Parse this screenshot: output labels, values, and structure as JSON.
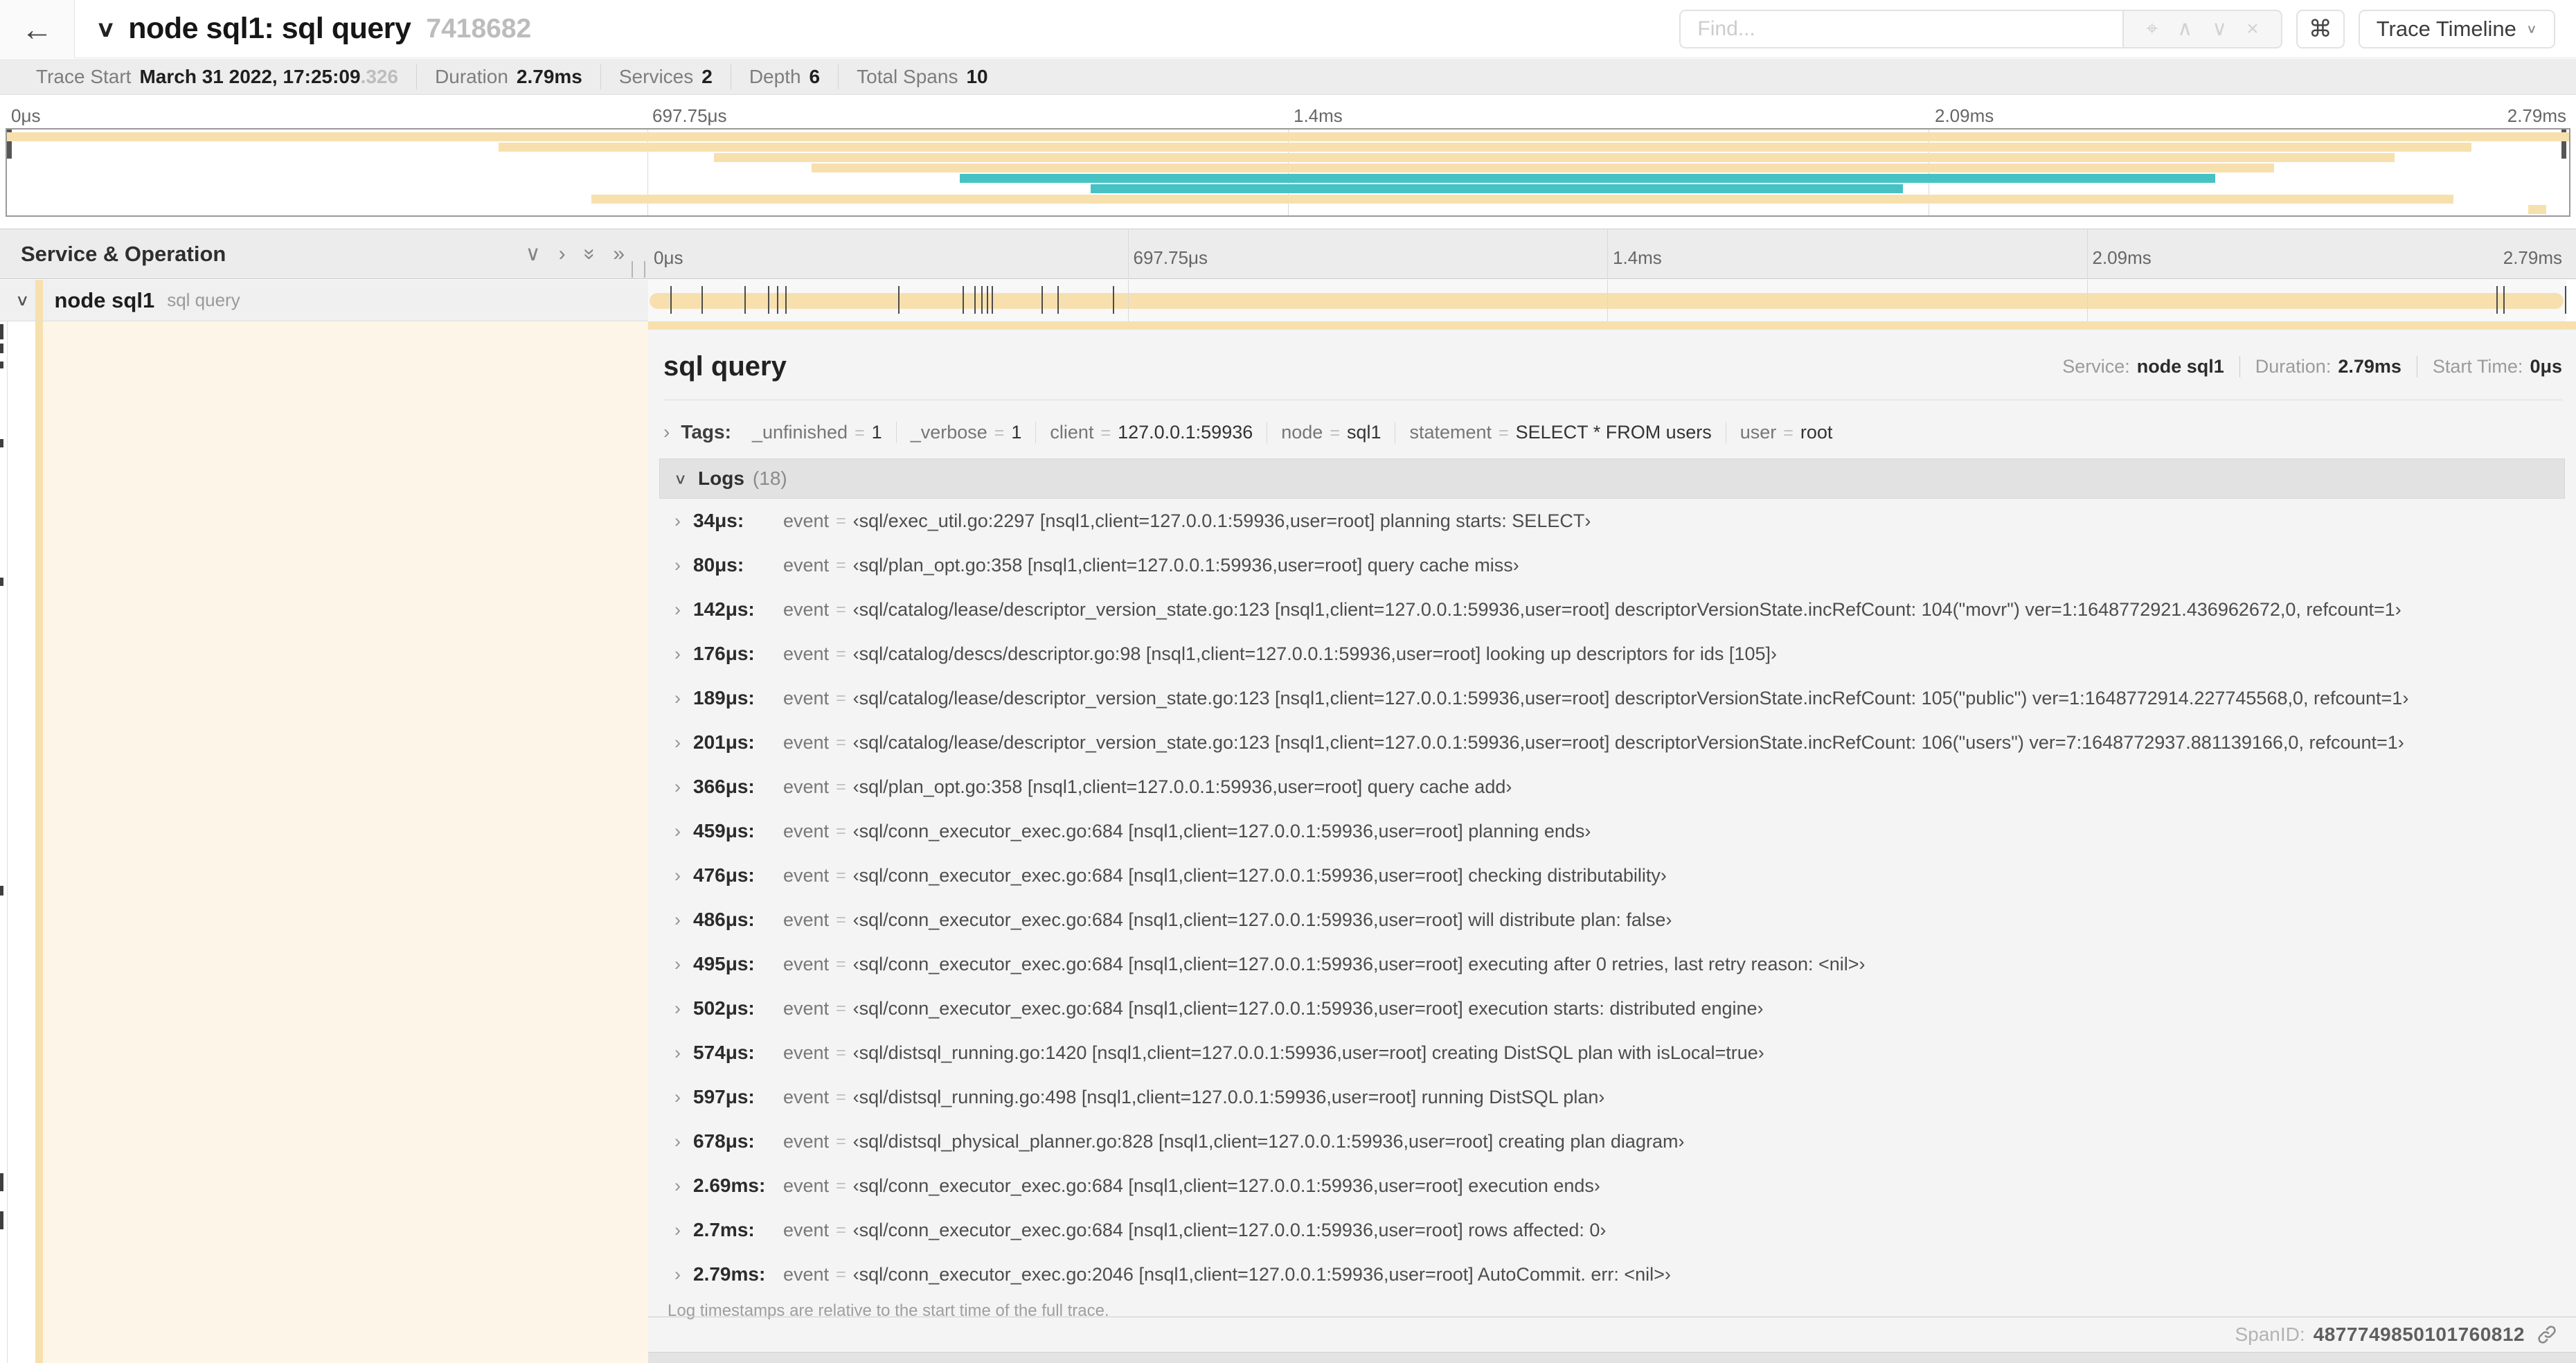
{
  "accent_colors": {
    "span_tan": "#f7e0ae",
    "span_teal": "#47c2c4",
    "detail_cream": "#fdf6e8"
  },
  "topbar": {
    "title": "node sql1: sql query",
    "trace_id": "7418682",
    "find_placeholder": "Find...",
    "shortcut_key": "⌘",
    "view_select_label": "Trace Timeline"
  },
  "meta": {
    "items": [
      {
        "label": "Trace Start",
        "value": "March 31 2022, 17:25:09",
        "suffix": ".326"
      },
      {
        "label": "Duration",
        "value": "2.79ms"
      },
      {
        "label": "Services",
        "value": "2"
      },
      {
        "label": "Depth",
        "value": "6"
      },
      {
        "label": "Total Spans",
        "value": "10"
      }
    ]
  },
  "ruler_labels": [
    "0μs",
    "697.75μs",
    "1.4ms",
    "2.09ms",
    "2.79ms"
  ],
  "duration_us": 2790,
  "minimap": {
    "spans": [
      {
        "row": 0,
        "start": 0.0,
        "end": 1.0,
        "color": "#f7e0ae"
      },
      {
        "row": 1,
        "start": 0.192,
        "end": 0.962,
        "color": "#f7e0ae"
      },
      {
        "row": 2,
        "start": 0.276,
        "end": 0.932,
        "color": "#f7e0ae"
      },
      {
        "row": 3,
        "start": 0.314,
        "end": 0.885,
        "color": "#f7e0ae"
      },
      {
        "row": 4,
        "start": 0.372,
        "end": 0.862,
        "color": "#47c2c4"
      },
      {
        "row": 5,
        "start": 0.423,
        "end": 0.74,
        "color": "#47c2c4"
      },
      {
        "row": 6,
        "start": 0.228,
        "end": 0.955,
        "color": "#f7e0ae"
      },
      {
        "row": 7,
        "start": 0.984,
        "end": 0.991,
        "color": "#f7e0ae"
      }
    ]
  },
  "timeline": {
    "column_header": "Service & Operation",
    "span": {
      "service": "node sql1",
      "operation": "sql query"
    }
  },
  "detail": {
    "title": "sql query",
    "overview": [
      {
        "label": "Service:",
        "value": "node sql1"
      },
      {
        "label": "Duration:",
        "value": "2.79ms"
      },
      {
        "label": "Start Time:",
        "value": "0μs"
      }
    ],
    "tags_label": "Tags:",
    "tags": [
      {
        "key": "_unfinished",
        "value": "1"
      },
      {
        "key": "_verbose",
        "value": "1"
      },
      {
        "key": "client",
        "value": "127.0.0.1:59936"
      },
      {
        "key": "node",
        "value": "sql1"
      },
      {
        "key": "statement",
        "value": "SELECT * FROM users"
      },
      {
        "key": "user",
        "value": "root"
      }
    ],
    "logs_label": "Logs",
    "logs_count": "(18)",
    "log_field_key": "event",
    "logs": [
      {
        "time": "34μs",
        "t": 34,
        "value": "‹sql/exec_util.go:2297 [nsql1,client=127.0.0.1:59936,user=root] planning starts: SELECT›"
      },
      {
        "time": "80μs",
        "t": 80,
        "value": "‹sql/plan_opt.go:358 [nsql1,client=127.0.0.1:59936,user=root] query cache miss›"
      },
      {
        "time": "142μs",
        "t": 142,
        "value": "‹sql/catalog/lease/descriptor_version_state.go:123 [nsql1,client=127.0.0.1:59936,user=root] descriptorVersionState.incRefCount: 104(\"movr\") ver=1:1648772921.436962672,0, refcount=1›"
      },
      {
        "time": "176μs",
        "t": 176,
        "value": "‹sql/catalog/descs/descriptor.go:98 [nsql1,client=127.0.0.1:59936,user=root] looking up descriptors for ids [105]›"
      },
      {
        "time": "189μs",
        "t": 189,
        "value": "‹sql/catalog/lease/descriptor_version_state.go:123 [nsql1,client=127.0.0.1:59936,user=root] descriptorVersionState.incRefCount: 105(\"public\") ver=1:1648772914.227745568,0, refcount=1›"
      },
      {
        "time": "201μs",
        "t": 201,
        "value": "‹sql/catalog/lease/descriptor_version_state.go:123 [nsql1,client=127.0.0.1:59936,user=root] descriptorVersionState.incRefCount: 106(\"users\") ver=7:1648772937.881139166,0, refcount=1›"
      },
      {
        "time": "366μs",
        "t": 366,
        "value": "‹sql/plan_opt.go:358 [nsql1,client=127.0.0.1:59936,user=root] query cache add›"
      },
      {
        "time": "459μs",
        "t": 459,
        "value": "‹sql/conn_executor_exec.go:684 [nsql1,client=127.0.0.1:59936,user=root] planning ends›"
      },
      {
        "time": "476μs",
        "t": 476,
        "value": "‹sql/conn_executor_exec.go:684 [nsql1,client=127.0.0.1:59936,user=root] checking distributability›"
      },
      {
        "time": "486μs",
        "t": 486,
        "value": "‹sql/conn_executor_exec.go:684 [nsql1,client=127.0.0.1:59936,user=root] will distribute plan: false›"
      },
      {
        "time": "495μs",
        "t": 495,
        "value": "‹sql/conn_executor_exec.go:684 [nsql1,client=127.0.0.1:59936,user=root] executing after 0 retries, last retry reason: <nil>›"
      },
      {
        "time": "502μs",
        "t": 502,
        "value": "‹sql/conn_executor_exec.go:684 [nsql1,client=127.0.0.1:59936,user=root] execution starts: distributed engine›"
      },
      {
        "time": "574μs",
        "t": 574,
        "value": "‹sql/distsql_running.go:1420 [nsql1,client=127.0.0.1:59936,user=root] creating DistSQL plan with isLocal=true›"
      },
      {
        "time": "597μs",
        "t": 597,
        "value": "‹sql/distsql_running.go:498 [nsql1,client=127.0.0.1:59936,user=root] running DistSQL plan›"
      },
      {
        "time": "678μs",
        "t": 678,
        "value": "‹sql/distsql_physical_planner.go:828 [nsql1,client=127.0.0.1:59936,user=root] creating plan diagram›"
      },
      {
        "time": "2.69ms",
        "t": 2690,
        "value": "‹sql/conn_executor_exec.go:684 [nsql1,client=127.0.0.1:59936,user=root] execution ends›"
      },
      {
        "time": "2.7ms",
        "t": 2700,
        "value": "‹sql/conn_executor_exec.go:684 [nsql1,client=127.0.0.1:59936,user=root] rows affected: 0›"
      },
      {
        "time": "2.79ms",
        "t": 2790,
        "value": "‹sql/conn_executor_exec.go:2046 [nsql1,client=127.0.0.1:59936,user=root] AutoCommit. err: <nil>›"
      }
    ],
    "footer": "Log timestamps are relative to the start time of the full trace.",
    "span_id_label": "SpanID:",
    "span_id": "4877749850101760812"
  }
}
